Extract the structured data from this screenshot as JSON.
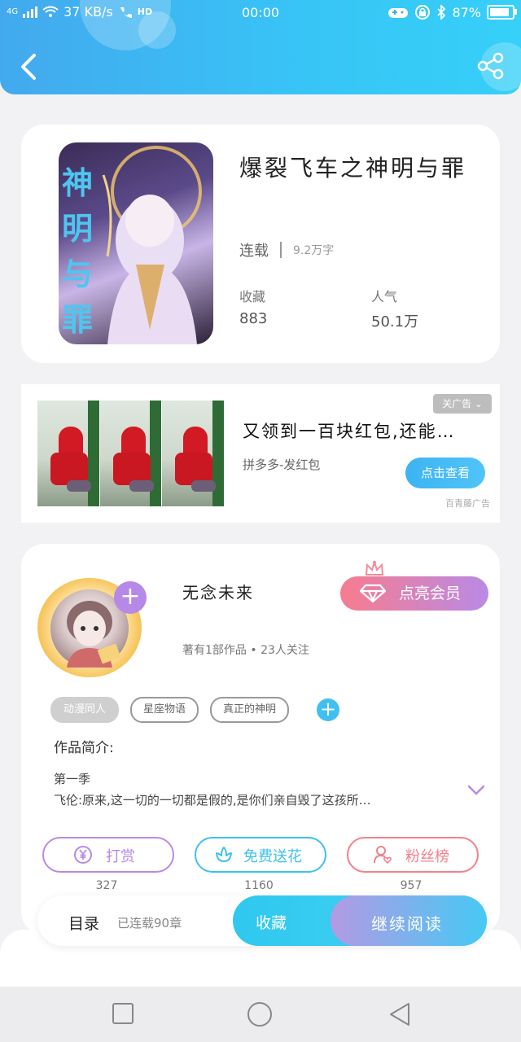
{
  "status_bar": {
    "network": "4G",
    "speed": "37 KB/s",
    "hd": "HD",
    "time": "00:00",
    "battery": "87%",
    "battery_level": 0.87
  },
  "header": {
    "back_icon": "chevron-left-icon",
    "share_icon": "share-icon"
  },
  "book": {
    "cover_text": "神明与罪",
    "title": "爆裂飞车之神明与罪",
    "status": "连载",
    "word_count": "9.2万字",
    "favorites_label": "收藏",
    "favorites_value": "883",
    "popularity_label": "人气",
    "popularity_value": "50.1万"
  },
  "ad": {
    "close_tag": "关广告 ⌄",
    "title": "又领到一百块红包,还能…",
    "source": "拼多多-发红包",
    "button": "点击查看",
    "note": "百青藤广告"
  },
  "author": {
    "name": "无念未来",
    "meta": "著有1部作品 • 23人关注",
    "vip_button": "点亮会员",
    "tags": [
      "动漫同人",
      "星座物语",
      "真正的神明"
    ],
    "intro_label": "作品简介:",
    "intro_lines": [
      "第一季",
      "飞伦:原来,这一切的一切都是假的,是你们亲自毁了这孩所…"
    ]
  },
  "actions": [
    {
      "label": "打赏",
      "icon": "yen-icon",
      "count": "327",
      "color": "#b98ae5"
    },
    {
      "label": "免费送花",
      "icon": "flower-icon",
      "count": "1160",
      "color": "#3fc0f0"
    },
    {
      "label": "粉丝榜",
      "icon": "user-heart-icon",
      "count": "957",
      "color": "#f3808e"
    }
  ],
  "bottom_bar": {
    "toc_label": "目录",
    "toc_info": "已连载90章",
    "collect": "收藏",
    "read": "继续阅读"
  },
  "nav": {
    "recent": "square-icon",
    "home": "circle-icon",
    "back": "triangle-back-icon"
  }
}
